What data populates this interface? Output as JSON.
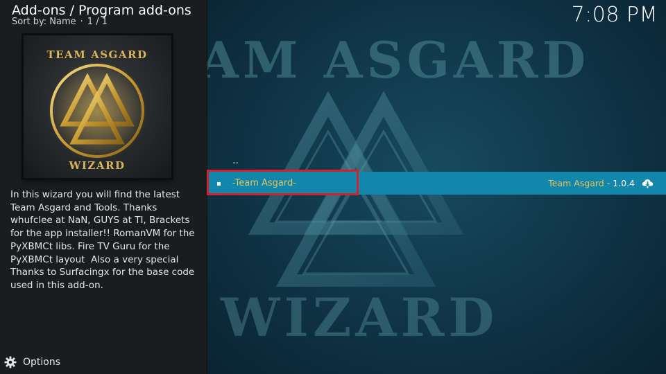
{
  "header": {
    "breadcrumb": "Add-ons / Program add-ons",
    "sort_label": "Sort by: Name",
    "sort_separator": "·",
    "page_counter": "1 / 1",
    "clock": "7:08 PM"
  },
  "thumbnail": {
    "logo_text_top": "TEAM ASGARD",
    "logo_text_bottom": "WIZARD"
  },
  "description": "In this wizard you will find the latest Team Asgard and Tools. Thanks whufclee at NaN, GUYS at TI, Brackets for the app installer!! RomanVM for the PyXBMCt libs. Fire TV Guru for the PyXBMCt layout  Also a very special Thanks to Surfacingx for the base code used in this add-on.",
  "options": {
    "label": "Options",
    "icon": "gear-icon"
  },
  "fanart": {
    "text_top": "AM ASGARD",
    "text_bottom": "WIZARD"
  },
  "list": {
    "parent_label": "..",
    "items": [
      {
        "label": "-Team Asgard-",
        "author": "Team Asgard",
        "separator": " - ",
        "version": "1.0.4",
        "icon": "cloud-download-icon"
      }
    ]
  },
  "colors": {
    "highlight_bar": "#1287ab",
    "label_gold": "#e7c35a",
    "annotation_red": "#d6202a"
  }
}
